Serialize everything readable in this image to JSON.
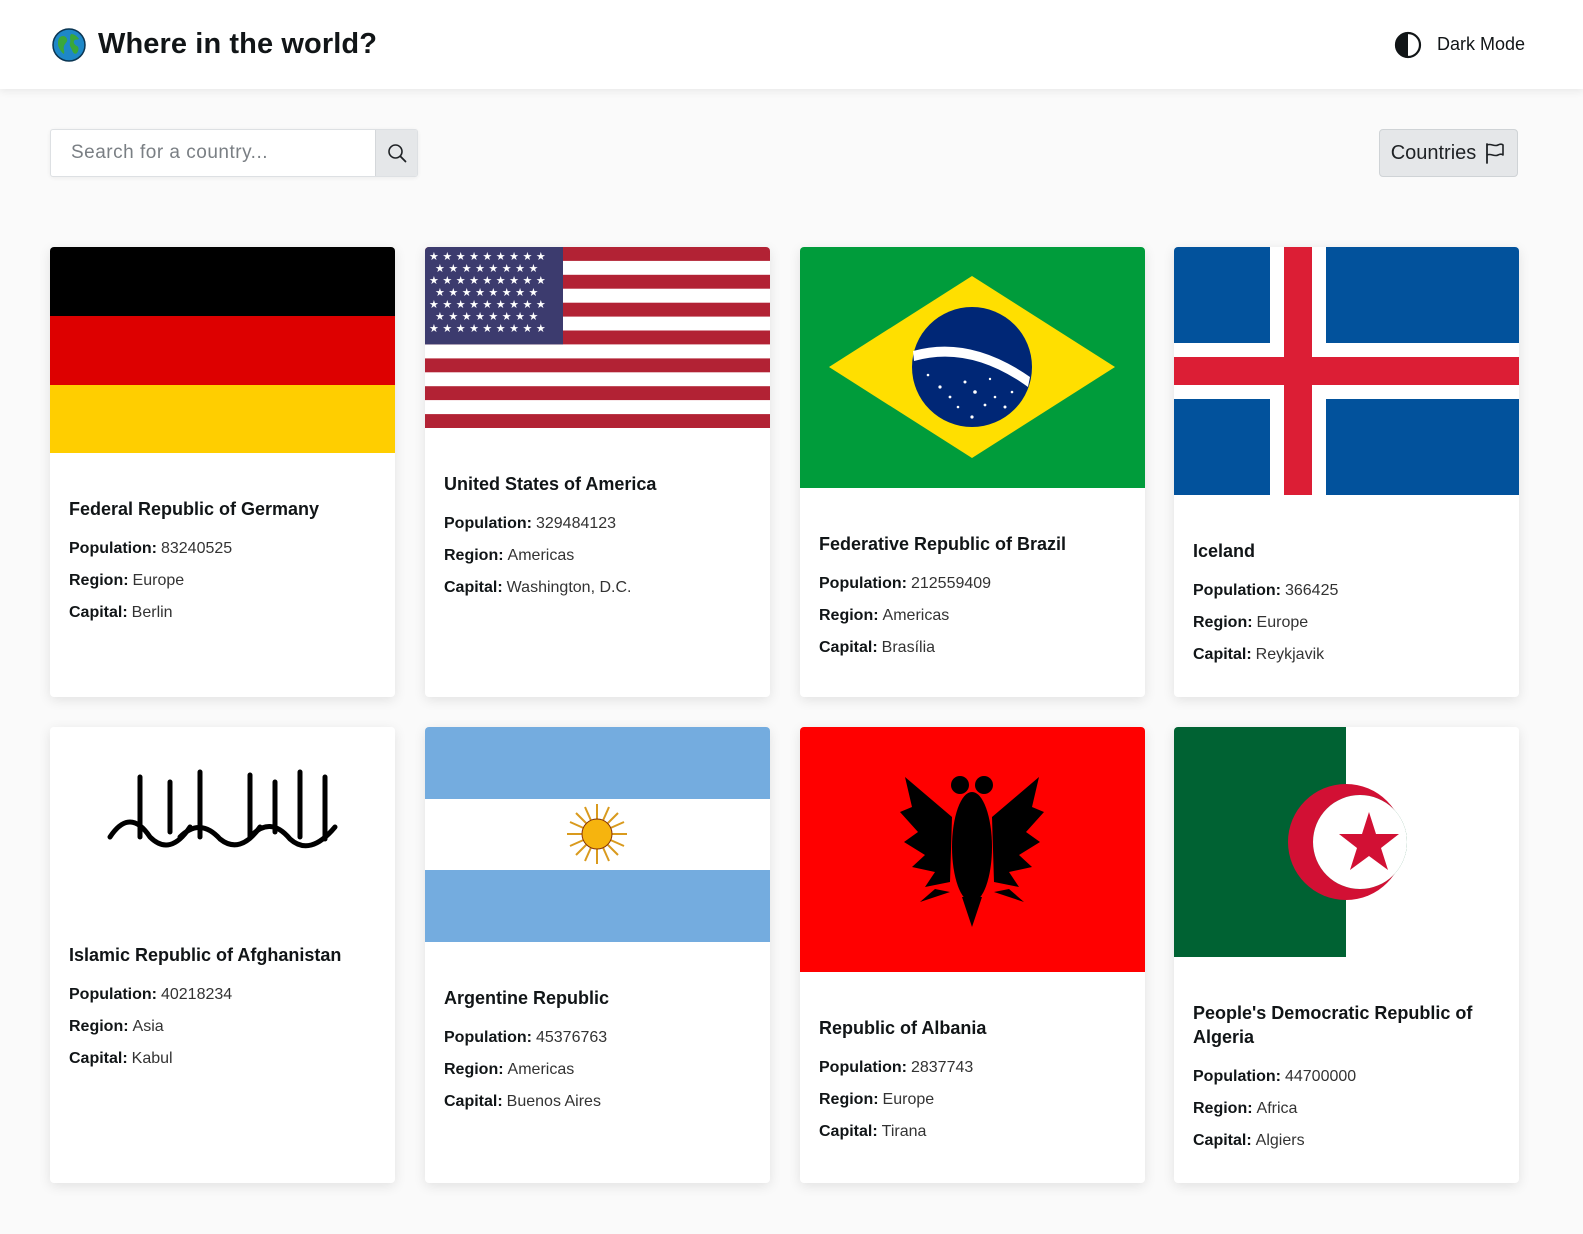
{
  "header": {
    "title": "Where in the world?",
    "dark_mode_label": "Dark Mode",
    "logo_icon": "globe-icon",
    "dark_mode_icon": "half-circle-contrast-icon"
  },
  "search": {
    "placeholder": "Search for a country...",
    "value": "",
    "button_icon": "search-icon"
  },
  "filter": {
    "label": "Countries",
    "icon": "flag-icon"
  },
  "labels": {
    "population": "Population:",
    "region": "Region:",
    "capital": "Capital:"
  },
  "countries": [
    {
      "name": "Federal Republic of Germany",
      "population": "83240525",
      "region": "Europe",
      "capital": "Berlin"
    },
    {
      "name": "United States of America",
      "population": "329484123",
      "region": "Americas",
      "capital": "Washington, D.C."
    },
    {
      "name": "Federative Republic of Brazil",
      "population": "212559409",
      "region": "Americas",
      "capital": "Brasília"
    },
    {
      "name": "Iceland",
      "population": "366425",
      "region": "Europe",
      "capital": "Reykjavik"
    },
    {
      "name": "Islamic Republic of Afghanistan",
      "population": "40218234",
      "region": "Asia",
      "capital": "Kabul"
    },
    {
      "name": "Argentine Republic",
      "population": "45376763",
      "region": "Americas",
      "capital": "Buenos Aires"
    },
    {
      "name": "Republic of Albania",
      "population": "2837743",
      "region": "Europe",
      "capital": "Tirana"
    },
    {
      "name": "People's Democratic Republic of Algeria",
      "population": "44700000",
      "region": "Africa",
      "capital": "Algiers"
    }
  ],
  "colors": {
    "background": "#fafafa",
    "surface": "#ffffff",
    "text": "#111517",
    "button_bg": "#e5e7e9"
  }
}
